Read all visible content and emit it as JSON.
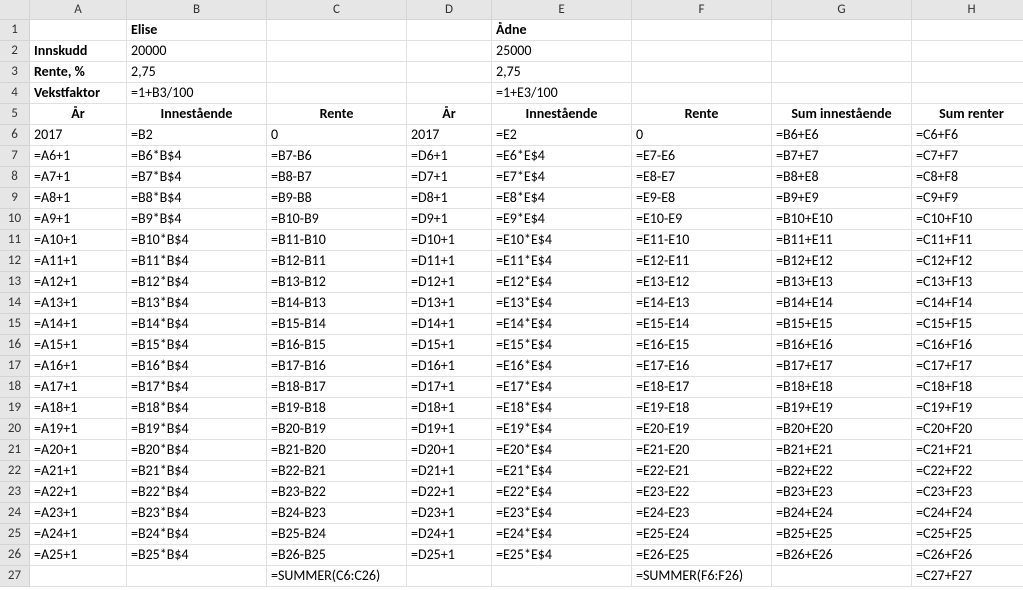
{
  "colHeaders": [
    "",
    "A",
    "B",
    "C",
    "D",
    "E",
    "F",
    "G",
    "H"
  ],
  "rows": [
    {
      "r": "1",
      "A": "",
      "B": "Elise",
      "C": "",
      "D": "",
      "E": "Ådne",
      "F": "",
      "G": "",
      "H": ""
    },
    {
      "r": "2",
      "A": "Innskudd",
      "B": "20000",
      "C": "",
      "D": "",
      "E": "25000",
      "F": "",
      "G": "",
      "H": ""
    },
    {
      "r": "3",
      "A": "Rente, %",
      "B": "2,75",
      "C": "",
      "D": "",
      "E": "2,75",
      "F": "",
      "G": "",
      "H": ""
    },
    {
      "r": "4",
      "A": "Vekstfaktor",
      "B": "=1+B3/100",
      "C": "",
      "D": "",
      "E": "=1+E3/100",
      "F": "",
      "G": "",
      "H": ""
    },
    {
      "r": "5",
      "A": "År",
      "B": "Innestående",
      "C": "Rente",
      "D": "År",
      "E": "Innestående",
      "F": "Rente",
      "G": "Sum innestående",
      "H": "Sum renter"
    },
    {
      "r": "6",
      "A": "2017",
      "B": "=B2",
      "C": "0",
      "D": "2017",
      "E": "=E2",
      "F": "0",
      "G": "=B6+E6",
      "H": "=C6+F6"
    },
    {
      "r": "7",
      "A": "=A6+1",
      "B": "=B6*B$4",
      "C": "=B7-B6",
      "D": "=D6+1",
      "E": "=E6*E$4",
      "F": "=E7-E6",
      "G": "=B7+E7",
      "H": "=C7+F7"
    },
    {
      "r": "8",
      "A": "=A7+1",
      "B": "=B7*B$4",
      "C": "=B8-B7",
      "D": "=D7+1",
      "E": "=E7*E$4",
      "F": "=E8-E7",
      "G": "=B8+E8",
      "H": "=C8+F8"
    },
    {
      "r": "9",
      "A": "=A8+1",
      "B": "=B8*B$4",
      "C": "=B9-B8",
      "D": "=D8+1",
      "E": "=E8*E$4",
      "F": "=E9-E8",
      "G": "=B9+E9",
      "H": "=C9+F9"
    },
    {
      "r": "10",
      "A": "=A9+1",
      "B": "=B9*B$4",
      "C": "=B10-B9",
      "D": "=D9+1",
      "E": "=E9*E$4",
      "F": "=E10-E9",
      "G": "=B10+E10",
      "H": "=C10+F10"
    },
    {
      "r": "11",
      "A": "=A10+1",
      "B": "=B10*B$4",
      "C": "=B11-B10",
      "D": "=D10+1",
      "E": "=E10*E$4",
      "F": "=E11-E10",
      "G": "=B11+E11",
      "H": "=C11+F11"
    },
    {
      "r": "12",
      "A": "=A11+1",
      "B": "=B11*B$4",
      "C": "=B12-B11",
      "D": "=D11+1",
      "E": "=E11*E$4",
      "F": "=E12-E11",
      "G": "=B12+E12",
      "H": "=C12+F12"
    },
    {
      "r": "13",
      "A": "=A12+1",
      "B": "=B12*B$4",
      "C": "=B13-B12",
      "D": "=D12+1",
      "E": "=E12*E$4",
      "F": "=E13-E12",
      "G": "=B13+E13",
      "H": "=C13+F13"
    },
    {
      "r": "14",
      "A": "=A13+1",
      "B": "=B13*B$4",
      "C": "=B14-B13",
      "D": "=D13+1",
      "E": "=E13*E$4",
      "F": "=E14-E13",
      "G": "=B14+E14",
      "H": "=C14+F14"
    },
    {
      "r": "15",
      "A": "=A14+1",
      "B": "=B14*B$4",
      "C": "=B15-B14",
      "D": "=D14+1",
      "E": "=E14*E$4",
      "F": "=E15-E14",
      "G": "=B15+E15",
      "H": "=C15+F15"
    },
    {
      "r": "16",
      "A": "=A15+1",
      "B": "=B15*B$4",
      "C": "=B16-B15",
      "D": "=D15+1",
      "E": "=E15*E$4",
      "F": "=E16-E15",
      "G": "=B16+E16",
      "H": "=C16+F16"
    },
    {
      "r": "17",
      "A": "=A16+1",
      "B": "=B16*B$4",
      "C": "=B17-B16",
      "D": "=D16+1",
      "E": "=E16*E$4",
      "F": "=E17-E16",
      "G": "=B17+E17",
      "H": "=C17+F17"
    },
    {
      "r": "18",
      "A": "=A17+1",
      "B": "=B17*B$4",
      "C": "=B18-B17",
      "D": "=D17+1",
      "E": "=E17*E$4",
      "F": "=E18-E17",
      "G": "=B18+E18",
      "H": "=C18+F18"
    },
    {
      "r": "19",
      "A": "=A18+1",
      "B": "=B18*B$4",
      "C": "=B19-B18",
      "D": "=D18+1",
      "E": "=E18*E$4",
      "F": "=E19-E18",
      "G": "=B19+E19",
      "H": "=C19+F19"
    },
    {
      "r": "20",
      "A": "=A19+1",
      "B": "=B19*B$4",
      "C": "=B20-B19",
      "D": "=D19+1",
      "E": "=E19*E$4",
      "F": "=E20-E19",
      "G": "=B20+E20",
      "H": "=C20+F20"
    },
    {
      "r": "21",
      "A": "=A20+1",
      "B": "=B20*B$4",
      "C": "=B21-B20",
      "D": "=D20+1",
      "E": "=E20*E$4",
      "F": "=E21-E20",
      "G": "=B21+E21",
      "H": "=C21+F21"
    },
    {
      "r": "22",
      "A": "=A21+1",
      "B": "=B21*B$4",
      "C": "=B22-B21",
      "D": "=D21+1",
      "E": "=E21*E$4",
      "F": "=E22-E21",
      "G": "=B22+E22",
      "H": "=C22+F22"
    },
    {
      "r": "23",
      "A": "=A22+1",
      "B": "=B22*B$4",
      "C": "=B23-B22",
      "D": "=D22+1",
      "E": "=E22*E$4",
      "F": "=E23-E22",
      "G": "=B23+E23",
      "H": "=C23+F23"
    },
    {
      "r": "24",
      "A": "=A23+1",
      "B": "=B23*B$4",
      "C": "=B24-B23",
      "D": "=D23+1",
      "E": "=E23*E$4",
      "F": "=E24-E23",
      "G": "=B24+E24",
      "H": "=C24+F24"
    },
    {
      "r": "25",
      "A": "=A24+1",
      "B": "=B24*B$4",
      "C": "=B25-B24",
      "D": "=D24+1",
      "E": "=E24*E$4",
      "F": "=E25-E24",
      "G": "=B25+E25",
      "H": "=C25+F25"
    },
    {
      "r": "26",
      "A": "=A25+1",
      "B": "=B25*B$4",
      "C": "=B26-B25",
      "D": "=D25+1",
      "E": "=E25*E$4",
      "F": "=E26-E25",
      "G": "=B26+E26",
      "H": "=C26+F26"
    },
    {
      "r": "27",
      "A": "",
      "B": "",
      "C": "=SUMMER(C6:C26)",
      "D": "",
      "E": "",
      "F": "=SUMMER(F6:F26)",
      "G": "",
      "H": "=C27+F27"
    }
  ]
}
